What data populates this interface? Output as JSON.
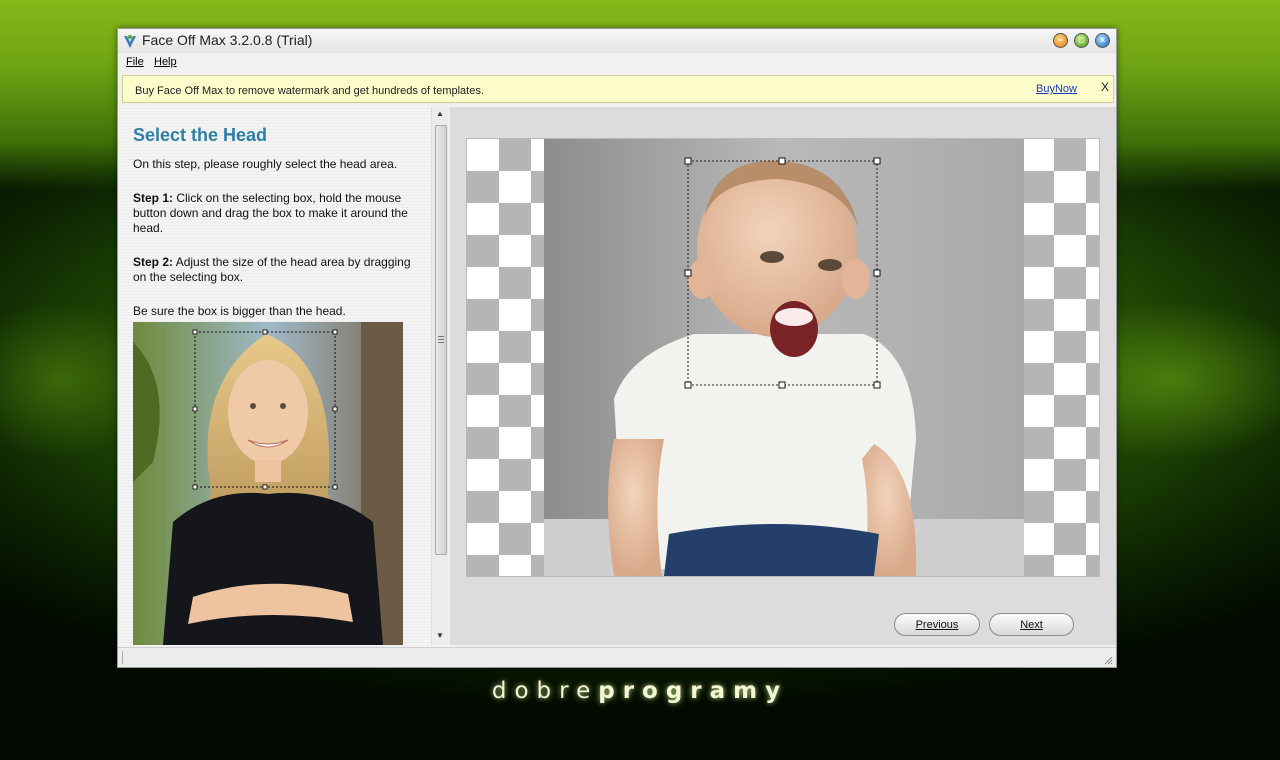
{
  "window": {
    "title": "Face Off Max  3.2.0.8  (Trial)"
  },
  "menu": {
    "items": [
      "File",
      "Help"
    ]
  },
  "notice": {
    "text": "Buy Face Off Max to remove watermark and get hundreds of templates.",
    "link": "BuyNow",
    "close": "X"
  },
  "instructions": {
    "title": "Select the Head",
    "intro": "On this step, please roughly select the head area.",
    "step1_label": "Step 1:",
    "step1_text": " Click on the selecting box, hold the mouse button down and drag the box to make it around the head.",
    "step2_label": "Step 2:",
    "step2_text": " Adjust the size of the head area by dragging on the selecting box.",
    "note": "Be sure the box is bigger than the head."
  },
  "buttons": {
    "previous": "Previous",
    "next": "Next"
  },
  "brand": {
    "light": "dobre",
    "bold": "programy"
  },
  "colors": {
    "title_accent": "#2e7fa8",
    "notice_bg": "#fdfccb",
    "link": "#1a3dbf",
    "background": "#4d8a10"
  }
}
